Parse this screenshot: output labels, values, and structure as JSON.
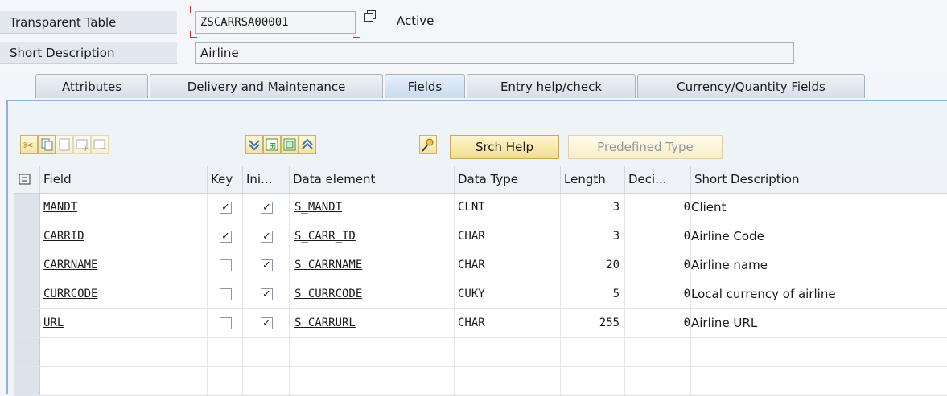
{
  "header": {
    "table_type_label": "Transparent Table",
    "table_name": "ZSCARRSA00001",
    "status": "Active",
    "short_desc_label": "Short Description",
    "short_desc_value": "Airline"
  },
  "tabs": [
    {
      "label": "Attributes"
    },
    {
      "label": "Delivery and Maintenance"
    },
    {
      "label": "Fields",
      "selected": true
    },
    {
      "label": "Entry help/check"
    },
    {
      "label": "Currency/Quantity Fields"
    }
  ],
  "toolbar": {
    "icons_left": [
      "cut-icon",
      "copy-icon",
      "paste-icon",
      "insert-row-icon",
      "delete-row-icon"
    ],
    "icons_mid": [
      "scroll-down-icon",
      "insert-block-icon",
      "select-all-icon",
      "scroll-up-icon"
    ],
    "search_help_icon": "search-help-icon",
    "srch_help_label": "Srch Help",
    "predefined_type_label": "Predefined Type"
  },
  "columns": {
    "field": "Field",
    "key": "Key",
    "initial": "Ini...",
    "data_element": "Data element",
    "data_type": "Data Type",
    "length": "Length",
    "decimals": "Deci...",
    "short_description": "Short Description"
  },
  "rows": [
    {
      "field": "MANDT",
      "key": true,
      "initial": true,
      "data_element": "S_MANDT",
      "data_type": "CLNT",
      "length": "3",
      "decimals": "0",
      "short_description": "Client"
    },
    {
      "field": "CARRID",
      "key": true,
      "initial": true,
      "data_element": "S_CARR_ID",
      "data_type": "CHAR",
      "length": "3",
      "decimals": "0",
      "short_description": "Airline Code"
    },
    {
      "field": "CARRNAME",
      "key": false,
      "initial": true,
      "data_element": "S_CARRNAME",
      "data_type": "CHAR",
      "length": "20",
      "decimals": "0",
      "short_description": "Airline name"
    },
    {
      "field": "CURRCODE",
      "key": false,
      "initial": true,
      "data_element": "S_CURRCODE",
      "data_type": "CUKY",
      "length": "5",
      "decimals": "0",
      "short_description": "Local currency of airline"
    },
    {
      "field": "URL",
      "key": false,
      "initial": true,
      "data_element": "S_CARRURL",
      "data_type": "CHAR",
      "length": "255",
      "decimals": "0",
      "short_description": "Airline URL"
    }
  ]
}
